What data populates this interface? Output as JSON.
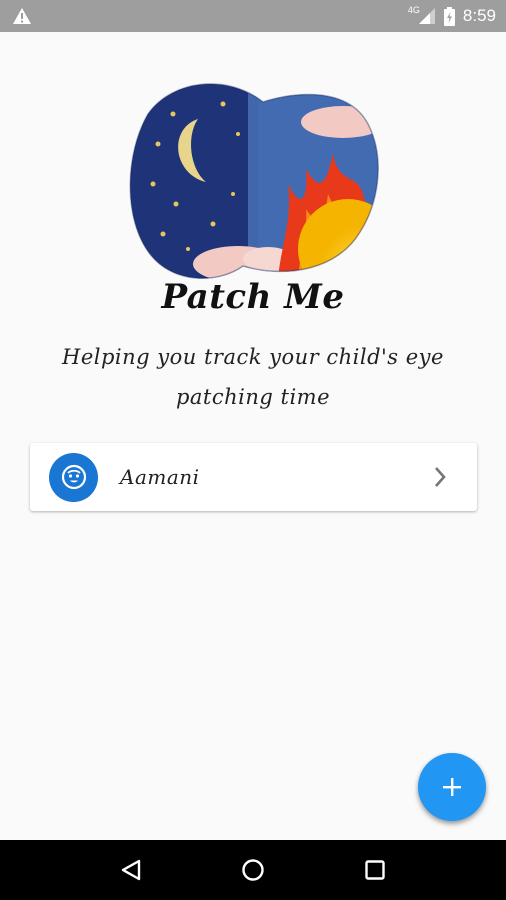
{
  "status_bar": {
    "time": "8:59",
    "network": "4G",
    "icons": [
      "warning-icon",
      "signal-icon",
      "battery-icon"
    ]
  },
  "app": {
    "title": "Patch Me",
    "subtitle": "Helping you track your child's eye patching time",
    "hero_image": "eye-patch-illustration"
  },
  "children": [
    {
      "name": "Aamani",
      "icon": "baby-face-icon",
      "action_icon": "chevron-right-icon"
    }
  ],
  "fab": {
    "icon": "plus-icon"
  },
  "nav_bar": {
    "buttons": [
      "back-icon",
      "home-icon",
      "recents-icon"
    ]
  },
  "colors": {
    "status_bar": "#9e9e9e",
    "background": "#fafafa",
    "avatar": "#1976d2",
    "fab": "#2196f3",
    "nav_bar": "#000000"
  }
}
